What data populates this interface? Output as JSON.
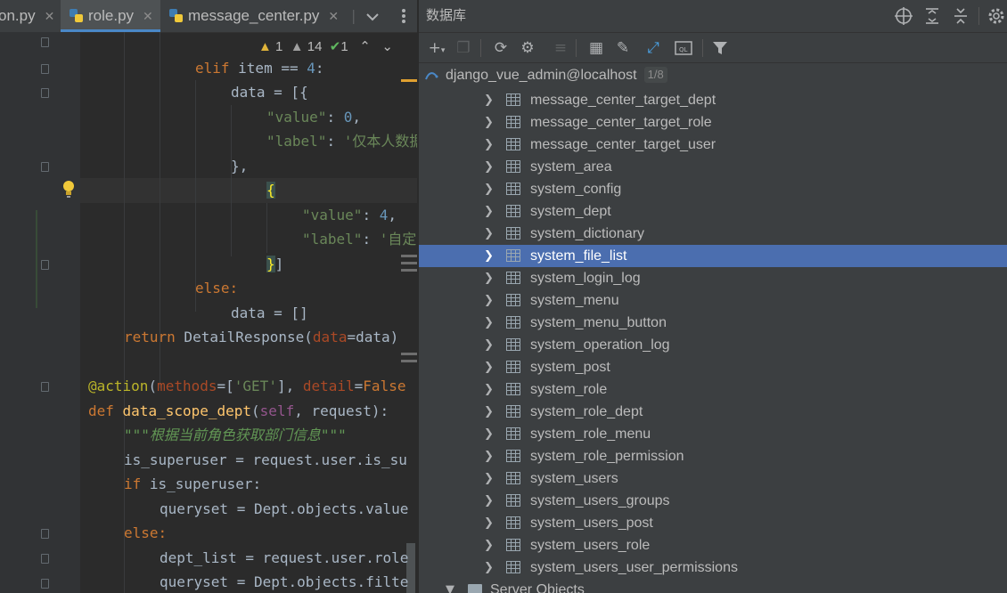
{
  "editor": {
    "tabs": [
      {
        "label": "on.py",
        "close": "✕"
      },
      {
        "label": "role.py",
        "close": "✕"
      },
      {
        "label": "message_center.py",
        "close": "✕"
      }
    ],
    "tab_overflow": "|",
    "inspections": {
      "warnings_1": "1",
      "warnings_2": "14",
      "ok": "1"
    },
    "code": {
      "l1_kw": "elif",
      "l1_rest": " item == ",
      "l1_num": "4",
      "l1_end": ":",
      "l2": "data = [{",
      "l3_key": "\"value\"",
      "l3_sep": ": ",
      "l3_num": "0",
      "l3_end": ",",
      "l4_key": "\"label\"",
      "l4_sep": ": ",
      "l4_str": "'仅本人数据",
      "l5": "},",
      "l6": "{",
      "l7_key": "\"value\"",
      "l7_sep": ": ",
      "l7_num": "4",
      "l7_end": ",",
      "l8_key": "\"label\"",
      "l8_sep": ": ",
      "l8_str": "'自定",
      "l9_a": "}",
      "l9_b": "]",
      "l10": "else:",
      "l11": "data = []",
      "l12_kw": "return",
      "l12_a": " DetailResponse(",
      "l12_p": "data",
      "l12_b": "=data)",
      "l13_deco": "@action",
      "l13_a": "(",
      "l13_p1": "methods",
      "l13_b": "=[",
      "l13_s": "'GET'",
      "l13_c": "], ",
      "l13_p2": "detail",
      "l13_d": "=",
      "l13_kw": "False",
      "l14_kw": "def",
      "l14_fn": " data_scope_dept",
      "l14_a": "(",
      "l14_self": "self",
      "l14_b": ", request):",
      "l15": "\"\"\"根据当前角色获取部门信息\"\"\"",
      "l16": "is_superuser = request.user.is_su",
      "l17_kw": "if",
      "l17_rest": " is_superuser:",
      "l18": "queryset = Dept.objects.value",
      "l19": "else:",
      "l20": "dept_list = request.user.role",
      "l21": "queryset = Dept.objects.filte"
    }
  },
  "database": {
    "title": "数据库",
    "connection": "django_vue_admin@localhost",
    "connection_badge": "1/8",
    "tables": [
      "message_center_target_dept",
      "message_center_target_role",
      "message_center_target_user",
      "system_area",
      "system_config",
      "system_dept",
      "system_dictionary",
      "system_file_list",
      "system_login_log",
      "system_menu",
      "system_menu_button",
      "system_operation_log",
      "system_post",
      "system_role",
      "system_role_dept",
      "system_role_menu",
      "system_role_permission",
      "system_users",
      "system_users_groups",
      "system_users_post",
      "system_users_role",
      "system_users_user_permissions"
    ],
    "selected_table": "system_file_list",
    "server_objects": "Server Objects"
  },
  "colors": {
    "selection": "#4b6eaf",
    "accent": "#4a88c7",
    "keyword": "#cc7832",
    "string": "#6a8759"
  }
}
